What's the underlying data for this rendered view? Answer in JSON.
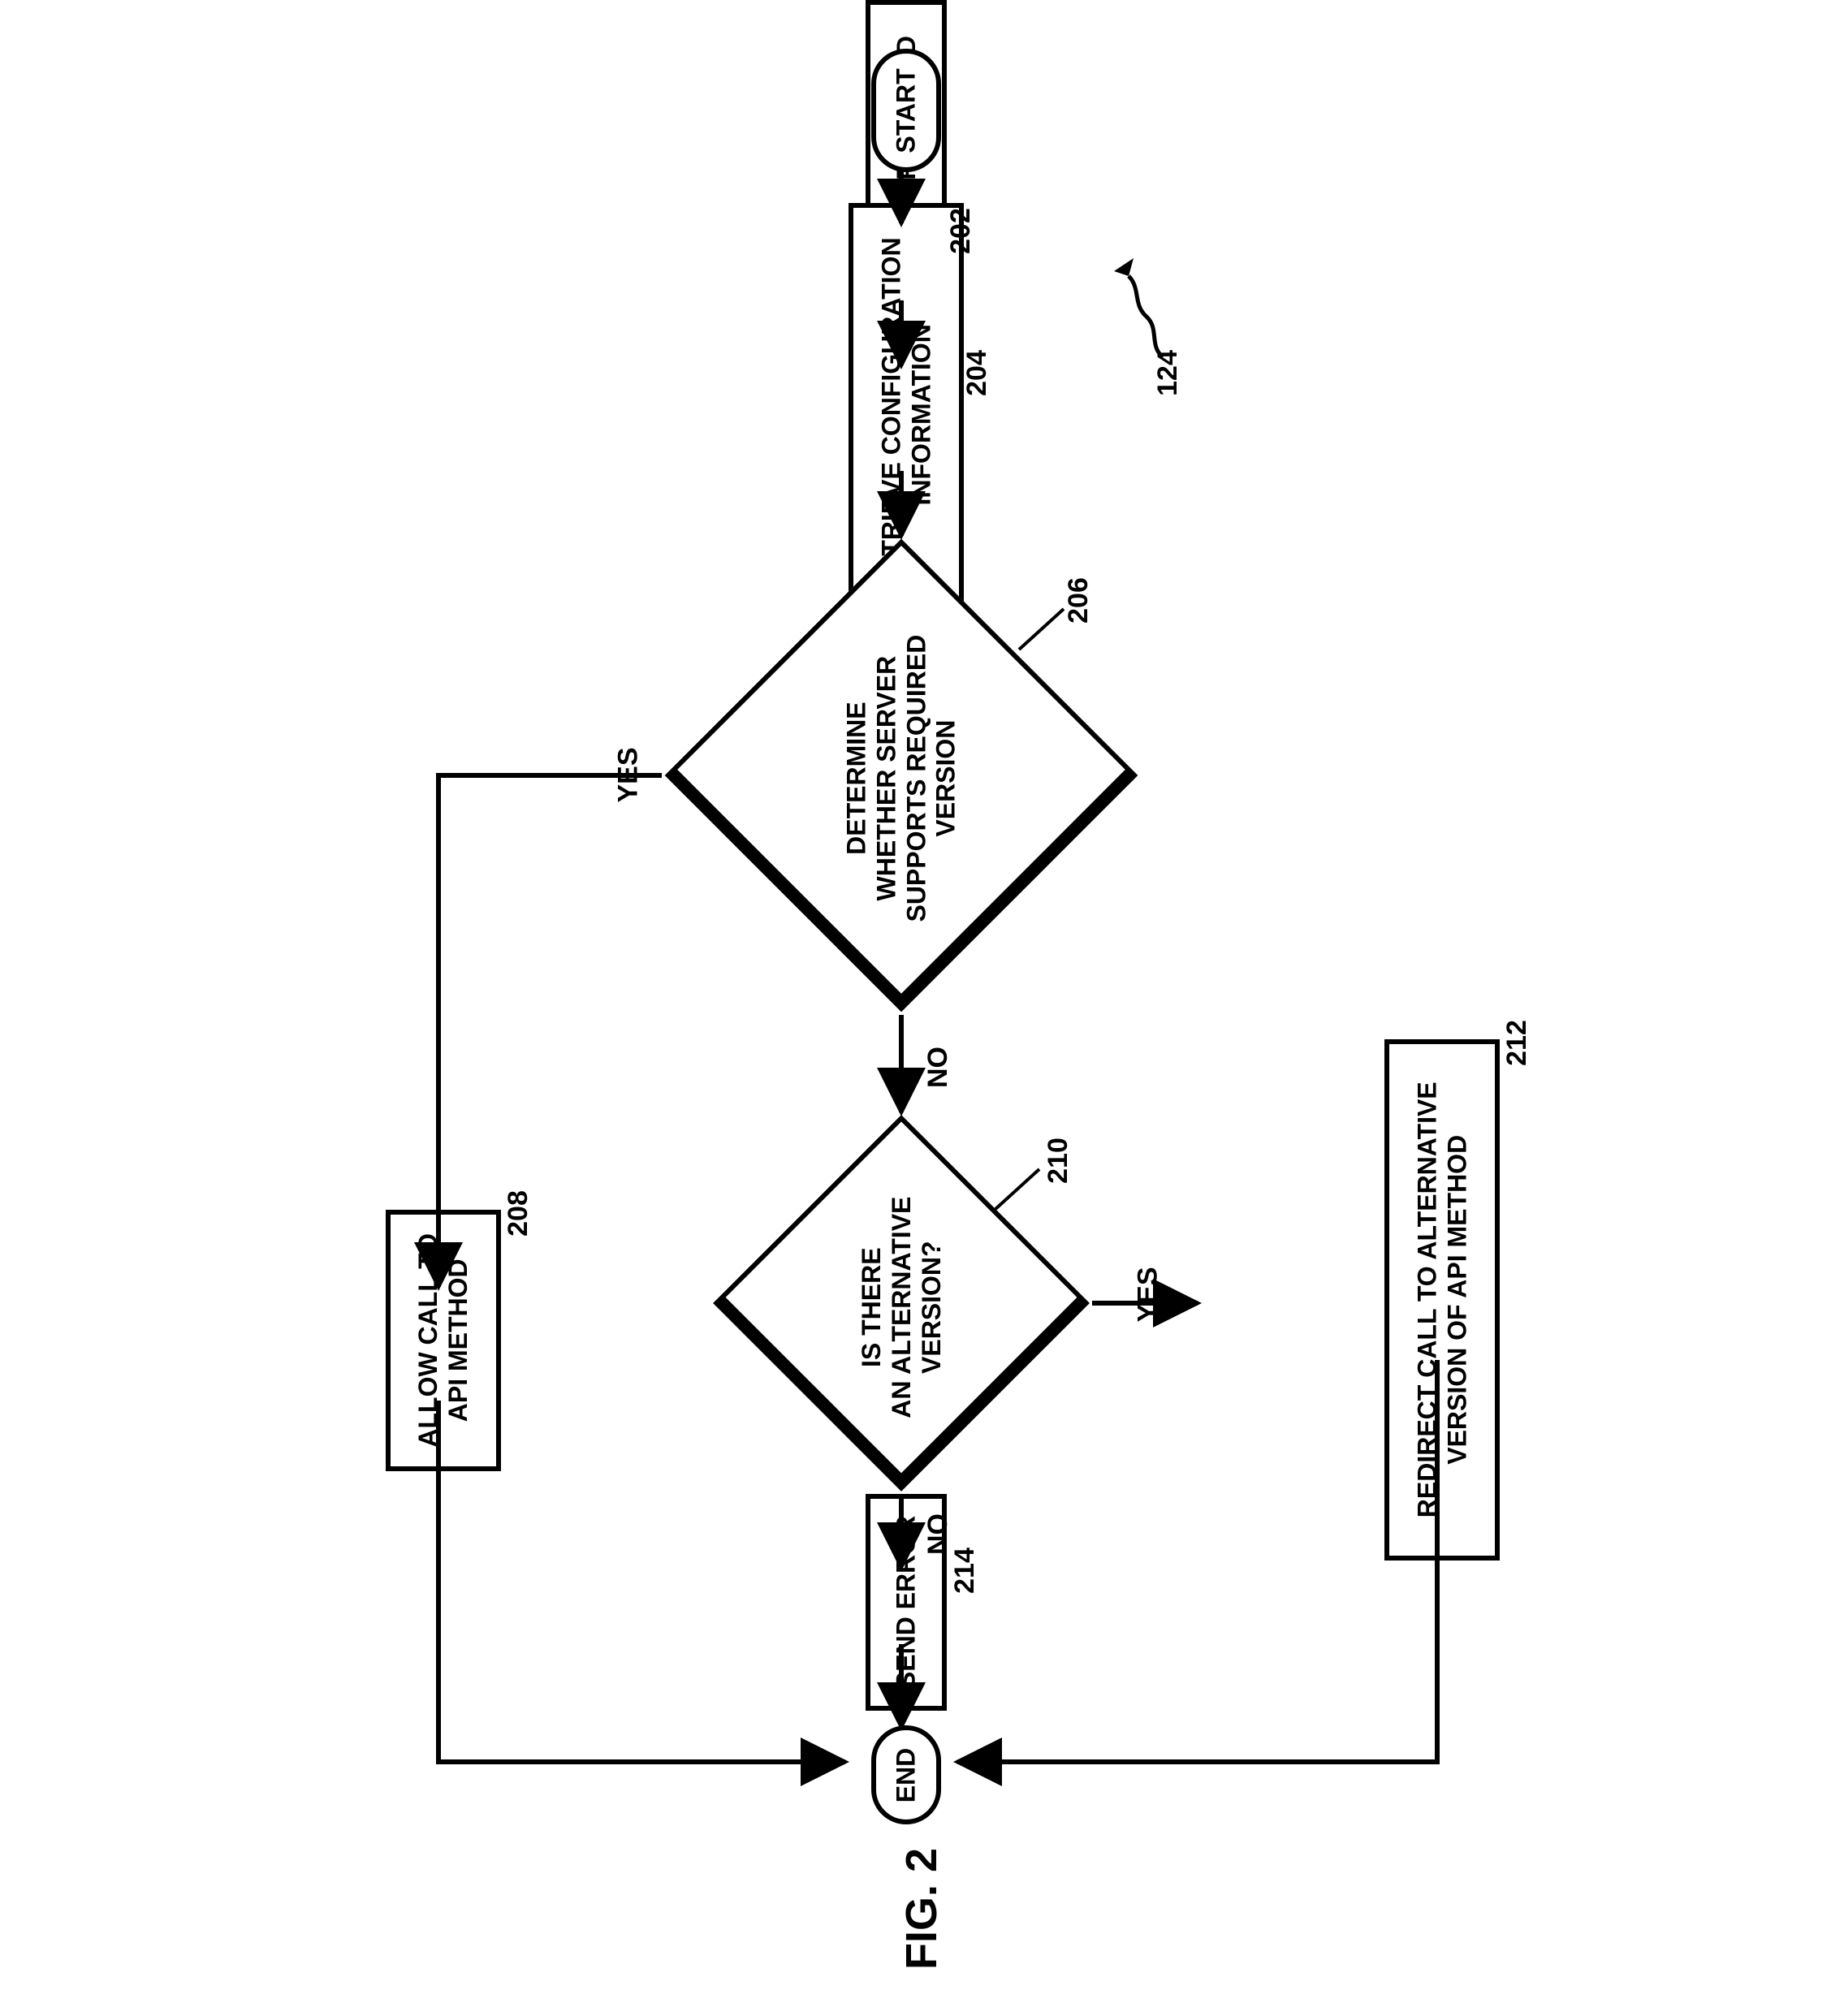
{
  "chart_data": {
    "type": "flowchart",
    "title": "FIG. 2",
    "reference_numeral": "124",
    "nodes": [
      {
        "id": "start",
        "type": "terminator",
        "label": "START"
      },
      {
        "id": "202",
        "type": "process",
        "label": "RECEIVE A CALL FOR API METHOD",
        "ref": "202"
      },
      {
        "id": "204",
        "type": "process",
        "label": "RETRIEVE CONFIGURATION INFORMATION",
        "ref": "204"
      },
      {
        "id": "206",
        "type": "decision",
        "label": "DETERMINE WHETHER SERVER SUPPORTS REQUIRED VERSION",
        "ref": "206"
      },
      {
        "id": "208",
        "type": "process",
        "label": "ALLOW CALL TO API METHOD",
        "ref": "208"
      },
      {
        "id": "210",
        "type": "decision",
        "label": "IS THERE AN ALTERNATIVE VERSION?",
        "ref": "210"
      },
      {
        "id": "212",
        "type": "process",
        "label": "REDIRECT CALL TO ALTERNATIVE VERSION OF API METHOD",
        "ref": "212"
      },
      {
        "id": "214",
        "type": "process",
        "label": "SEND ERROR",
        "ref": "214"
      },
      {
        "id": "end",
        "type": "terminator",
        "label": "END"
      }
    ],
    "edges": [
      {
        "from": "start",
        "to": "202"
      },
      {
        "from": "202",
        "to": "204"
      },
      {
        "from": "204",
        "to": "206"
      },
      {
        "from": "206",
        "to": "208",
        "label": "YES"
      },
      {
        "from": "206",
        "to": "210",
        "label": "NO"
      },
      {
        "from": "210",
        "to": "212",
        "label": "YES"
      },
      {
        "from": "210",
        "to": "214",
        "label": "NO"
      },
      {
        "from": "208",
        "to": "end"
      },
      {
        "from": "212",
        "to": "end"
      },
      {
        "from": "214",
        "to": "end"
      }
    ]
  },
  "nodes": {
    "start": "START",
    "end": "END",
    "n202": {
      "text": "RECEIVE A CALL FOR API METHOD",
      "ref": "202"
    },
    "n204": {
      "line1": "RETRIEVE CONFIGURATION",
      "line2": "INFORMATION",
      "ref": "204"
    },
    "n206": {
      "l1": "DETERMINE",
      "l2": "WHETHER SERVER",
      "l3": "SUPPORTS REQUIRED",
      "l4": "VERSION",
      "ref": "206"
    },
    "n208": {
      "line1": "ALLOW CALL TO",
      "line2": "API METHOD",
      "ref": "208"
    },
    "n210": {
      "l1": "IS THERE",
      "l2": "AN ALTERNATIVE",
      "l3": "VERSION?",
      "ref": "210"
    },
    "n212": {
      "line1": "REDIRECT CALL TO ALTERNATIVE",
      "line2": "VERSION OF API METHOD",
      "ref": "212"
    },
    "n214": {
      "text": "SEND ERROR",
      "ref": "214"
    }
  },
  "edges": {
    "yes": "YES",
    "no": "NO"
  },
  "figure": {
    "label": "FIG. 2",
    "ref": "124"
  }
}
